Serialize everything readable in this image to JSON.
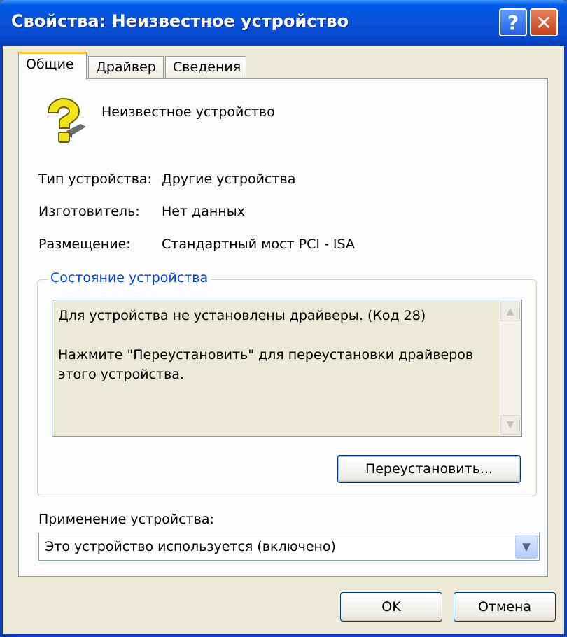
{
  "window": {
    "title": "Свойства: Неизвестное устройство",
    "help_button": "?",
    "close_button": "✕"
  },
  "tabs": [
    {
      "label": "Общие",
      "active": true
    },
    {
      "label": "Драйвер",
      "active": false
    },
    {
      "label": "Сведения",
      "active": false
    }
  ],
  "device": {
    "name": "Неизвестное устройство",
    "icon": "unknown-device-question-icon"
  },
  "properties": [
    {
      "label": "Тип устройства:",
      "value": "Другие устройства"
    },
    {
      "label": "Изготовитель:",
      "value": "Нет данных"
    },
    {
      "label": "Размещение:",
      "value": "Стандартный мост PCI - ISA"
    }
  ],
  "status": {
    "group_title": "Состояние устройства",
    "text": "Для устройства не установлены драйверы. (Код 28)\n\nНажмите \"Переустановить\" для переустановки драйверов этого устройства.",
    "reinstall_button": "Переустановить..."
  },
  "usage": {
    "label": "Применение устройства:",
    "value": "Это устройство используется (включено)"
  },
  "buttons": {
    "ok": "OK",
    "cancel": "Отмена"
  },
  "colors": {
    "titlebar": "#0a52d8",
    "dialog_bg": "#ece9d8",
    "group_title": "#0046d5",
    "active_tab_accent": "#ffc83c"
  }
}
